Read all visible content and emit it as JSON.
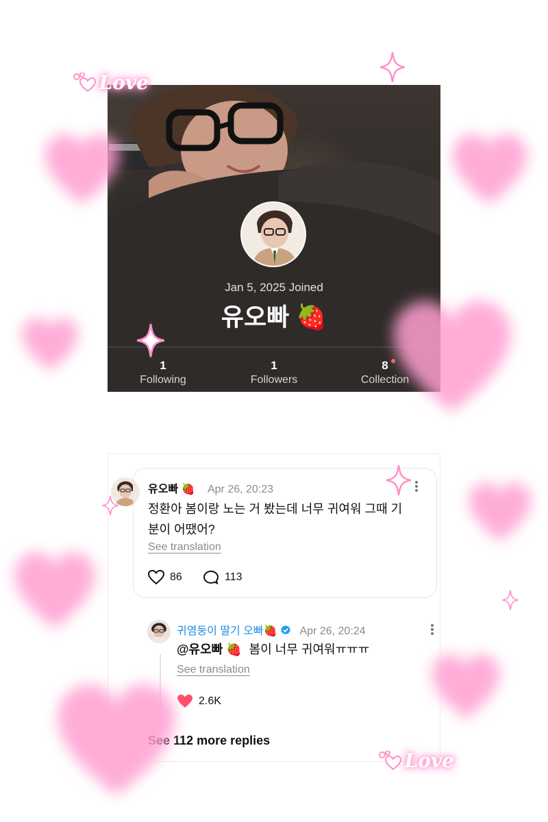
{
  "profile": {
    "joined": "Jan 5, 2025 Joined",
    "name": "유오빠 🍓",
    "stats": [
      {
        "value": "1",
        "label": "Following"
      },
      {
        "value": "1",
        "label": "Followers"
      },
      {
        "value": "8",
        "label": "Collection"
      }
    ]
  },
  "comment": {
    "author": "유오빠 🍓",
    "time": "Apr 26, 20:23",
    "text": "정환아 봄이랑 노는 거 봤는데 너무 귀여워 그때 기분이 어땠어?",
    "see_translation": "See translation",
    "likes": "86",
    "replies": "113"
  },
  "reply": {
    "author": "귀염둥이 딸기 오빠🍓",
    "time": "Apr 26, 20:24",
    "mention": "@유오빠 🍓",
    "text": "봄이 너무 귀여워ㅠㅠㅠ",
    "see_translation": "See translation",
    "likes": "2.6K"
  },
  "more_replies": "See 112 more replies",
  "decorations": {
    "love_label": "Love",
    "heart_color": "#ff9fd1",
    "liked_heart_color": "#ff4d6d",
    "verified_color": "#1da1f2"
  }
}
